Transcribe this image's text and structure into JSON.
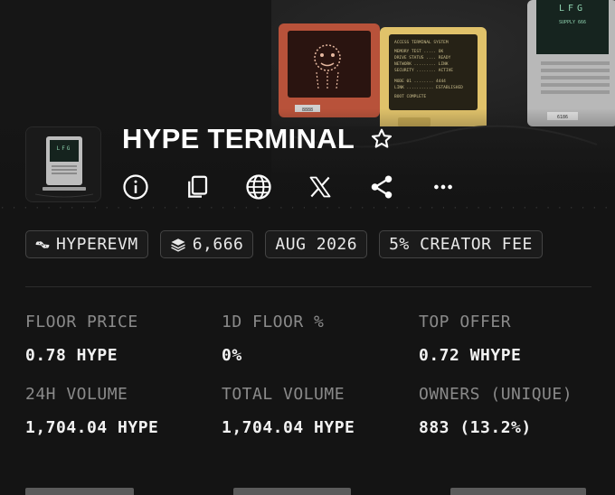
{
  "collection": {
    "title": "HYPE TERMINAL",
    "avatar_text": "LFG"
  },
  "banner": {
    "terminal_text": "LFG",
    "subtext": "SUPPLY 666",
    "label_left": "8888",
    "label_right": "6186"
  },
  "chips": [
    {
      "icon": "hyperevm-logo-icon",
      "label": "HYPEREVM"
    },
    {
      "icon": "layers-icon",
      "label": "6,666"
    },
    {
      "icon": "",
      "label": "AUG 2026"
    },
    {
      "icon": "",
      "label": "5% CREATOR FEE"
    }
  ],
  "stats": [
    {
      "label": "FLOOR PRICE",
      "value": "0.78 HYPE"
    },
    {
      "label": "1D FLOOR %",
      "value": "0%"
    },
    {
      "label": "TOP OFFER",
      "value": "0.72 WHYPE"
    },
    {
      "label": "24H VOLUME",
      "value": "1,704.04 HYPE"
    },
    {
      "label": "TOTAL VOLUME",
      "value": "1,704.04 HYPE"
    },
    {
      "label": "OWNERS (UNIQUE)",
      "value": "883 (13.2%)"
    }
  ],
  "icons": {
    "favorite": "star-outline-icon",
    "info": "info-icon",
    "copy": "copy-icon",
    "website": "globe-icon",
    "x": "x-logo-icon",
    "share": "share-icon",
    "more": "more-icon"
  },
  "colors": {
    "background": "#141414",
    "text": "#ffffff",
    "muted": "#8a8a8a",
    "chip_border": "#444444"
  }
}
